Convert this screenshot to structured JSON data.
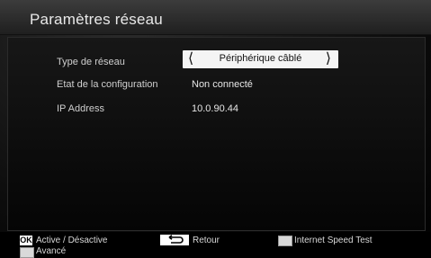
{
  "window": {
    "title": "Paramètres réseau"
  },
  "settings": {
    "network_type": {
      "label": "Type de réseau",
      "value": "Périphérique câblé"
    },
    "config_state": {
      "label": "Etat de la configuration",
      "value": "Non connecté"
    },
    "ip_address": {
      "label": "IP Address",
      "value": "10.0.90.44"
    }
  },
  "footer": {
    "ok_badge": "OK",
    "ok_label": "Active / Désactive",
    "back_icon": "return-arrow-icon",
    "back_label": "Retour",
    "speed_test_label": "Internet Speed Test",
    "advanced_label": "Avancé"
  },
  "colors": {
    "background": "#000000",
    "selector": "#f4f4f4",
    "text": "#e6e6e6"
  }
}
